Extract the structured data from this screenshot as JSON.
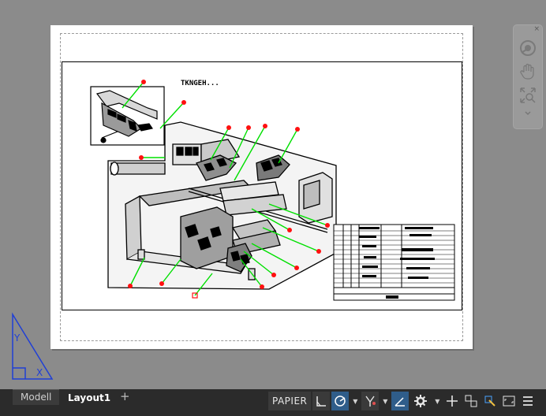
{
  "layout_tabs": [
    {
      "label": "Modell",
      "active": false
    },
    {
      "label": "Layout1",
      "active": true
    }
  ],
  "add_tab_label": "+",
  "status_bar": {
    "space_label": "PAPIER",
    "icons": [
      "snap-grid-icon",
      "polar-tracking-icon",
      "isodraft-icon",
      "lineweight-icon",
      "gear-icon",
      "crosshair-icon",
      "viewport-scale-icon",
      "annotation-monitor-icon",
      "fullscreen-icon",
      "menu-icon"
    ]
  },
  "navbar": {
    "close_label": "×",
    "icons": [
      "steering-wheel-icon",
      "pan-hand-icon",
      "zoom-extents-icon",
      "chevron-down-icon"
    ]
  },
  "drawing": {
    "title_text": "TKNGEH...",
    "detail_label": "1",
    "colors": {
      "leader": "#00e000",
      "balloon": "#ff1010",
      "canvas_bg": "#8b8b8b",
      "paper": "#ffffff",
      "tab_bg": "#2b2b2b",
      "active_status": "#2f5d8a"
    }
  }
}
